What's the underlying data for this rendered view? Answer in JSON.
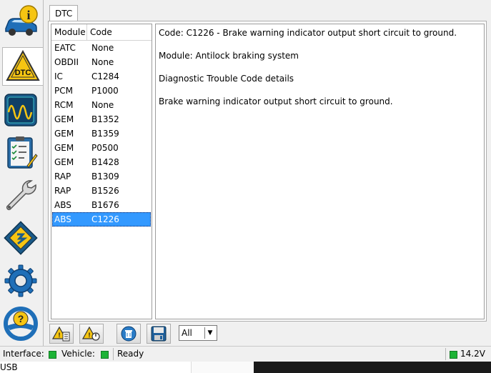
{
  "tabs": [
    {
      "label": "DTC"
    }
  ],
  "dtc_list": {
    "columns": [
      "Module",
      "Code"
    ],
    "rows": [
      {
        "module": "EATC",
        "code": "None"
      },
      {
        "module": "OBDII",
        "code": "None"
      },
      {
        "module": "IC",
        "code": "C1284"
      },
      {
        "module": "PCM",
        "code": "P1000"
      },
      {
        "module": "RCM",
        "code": "None"
      },
      {
        "module": "GEM",
        "code": "B1352"
      },
      {
        "module": "GEM",
        "code": "B1359"
      },
      {
        "module": "GEM",
        "code": "P0500"
      },
      {
        "module": "GEM",
        "code": "B1428"
      },
      {
        "module": "RAP",
        "code": "B1309"
      },
      {
        "module": "RAP",
        "code": "B1526"
      },
      {
        "module": "ABS",
        "code": "B1676"
      },
      {
        "module": "ABS",
        "code": "C1226"
      }
    ],
    "selected_index": 12
  },
  "detail": {
    "code_line": "Code: C1226 - Brake warning indicator output short circuit to ground.",
    "module_line": "Module: Antilock braking system",
    "section_title": "Diagnostic Trouble Code details",
    "description": "Brake warning indicator output short circuit to ground."
  },
  "toolbar": {
    "filter_value": "All",
    "icons": [
      "warning-list-icon",
      "warning-clear-icon",
      "delete-icon",
      "save-icon"
    ]
  },
  "sidebar": {
    "icons": [
      "info-car-icon",
      "dtc-icon",
      "oscilloscope-icon",
      "checklist-icon",
      "wrench-icon",
      "chip-icon",
      "gear-icon",
      "help-steering-icon"
    ],
    "active_index": 1
  },
  "statusbar": {
    "interface_label": "Interface:",
    "vehicle_label": "Vehicle:",
    "status_text": "Ready",
    "voltage": "14.2V",
    "led_color": "#1db336"
  },
  "taskbar": {
    "usb_text": "USB"
  }
}
